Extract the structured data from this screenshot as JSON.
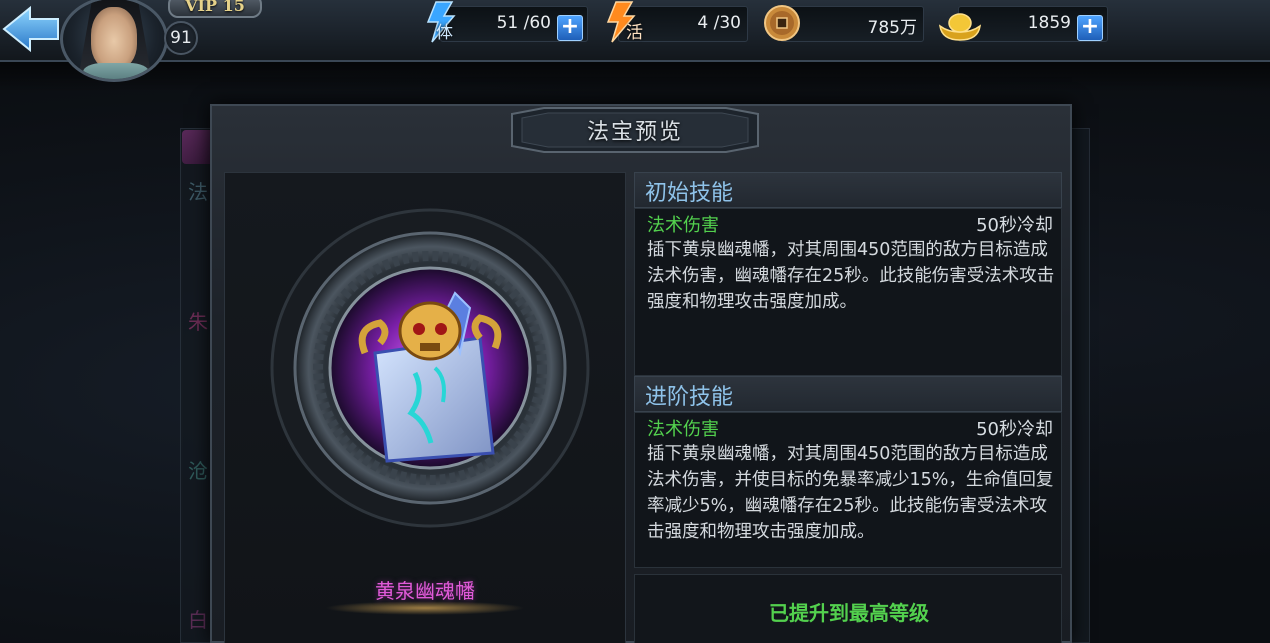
{
  "header": {
    "vip_label": "VIP 15",
    "level": "91",
    "stamina": {
      "label": "体",
      "value": "51 /60"
    },
    "vitality": {
      "label": "活",
      "value": "4 /30"
    },
    "coins": {
      "value": "785万"
    },
    "ingots": {
      "value": "1859"
    }
  },
  "background": {
    "glyphs": [
      "法",
      "朱",
      "沧",
      "白"
    ]
  },
  "dialog": {
    "title": "法宝预览",
    "treasure_name": "黄泉幽魂幡",
    "initial_skill": {
      "header": "初始技能",
      "type": "法术伤害",
      "cooldown": "50秒冷却",
      "description": "插下黄泉幽魂幡，对其周围450范围的敌方目标造成法术伤害，幽魂幡存在25秒。此技能伤害受法术攻击强度和物理攻击强度加成。"
    },
    "advanced_skill": {
      "header": "进阶技能",
      "type": "法术伤害",
      "cooldown": "50秒冷却",
      "description": "插下黄泉幽魂幡，对其周围450范围的敌方目标造成法术伤害，并使目标的免暴率减少15%，生命值回复率减少5%，幽魂幡存在25秒。此技能伤害受法术攻击强度和物理攻击强度加成。"
    },
    "max_level_text": "已提升到最高等级"
  },
  "colors": {
    "skill_header": "#8fc3ea",
    "skill_type": "#53d14e",
    "treasure_name": "#e05ad8",
    "plus_button": "#1f5fb8"
  }
}
